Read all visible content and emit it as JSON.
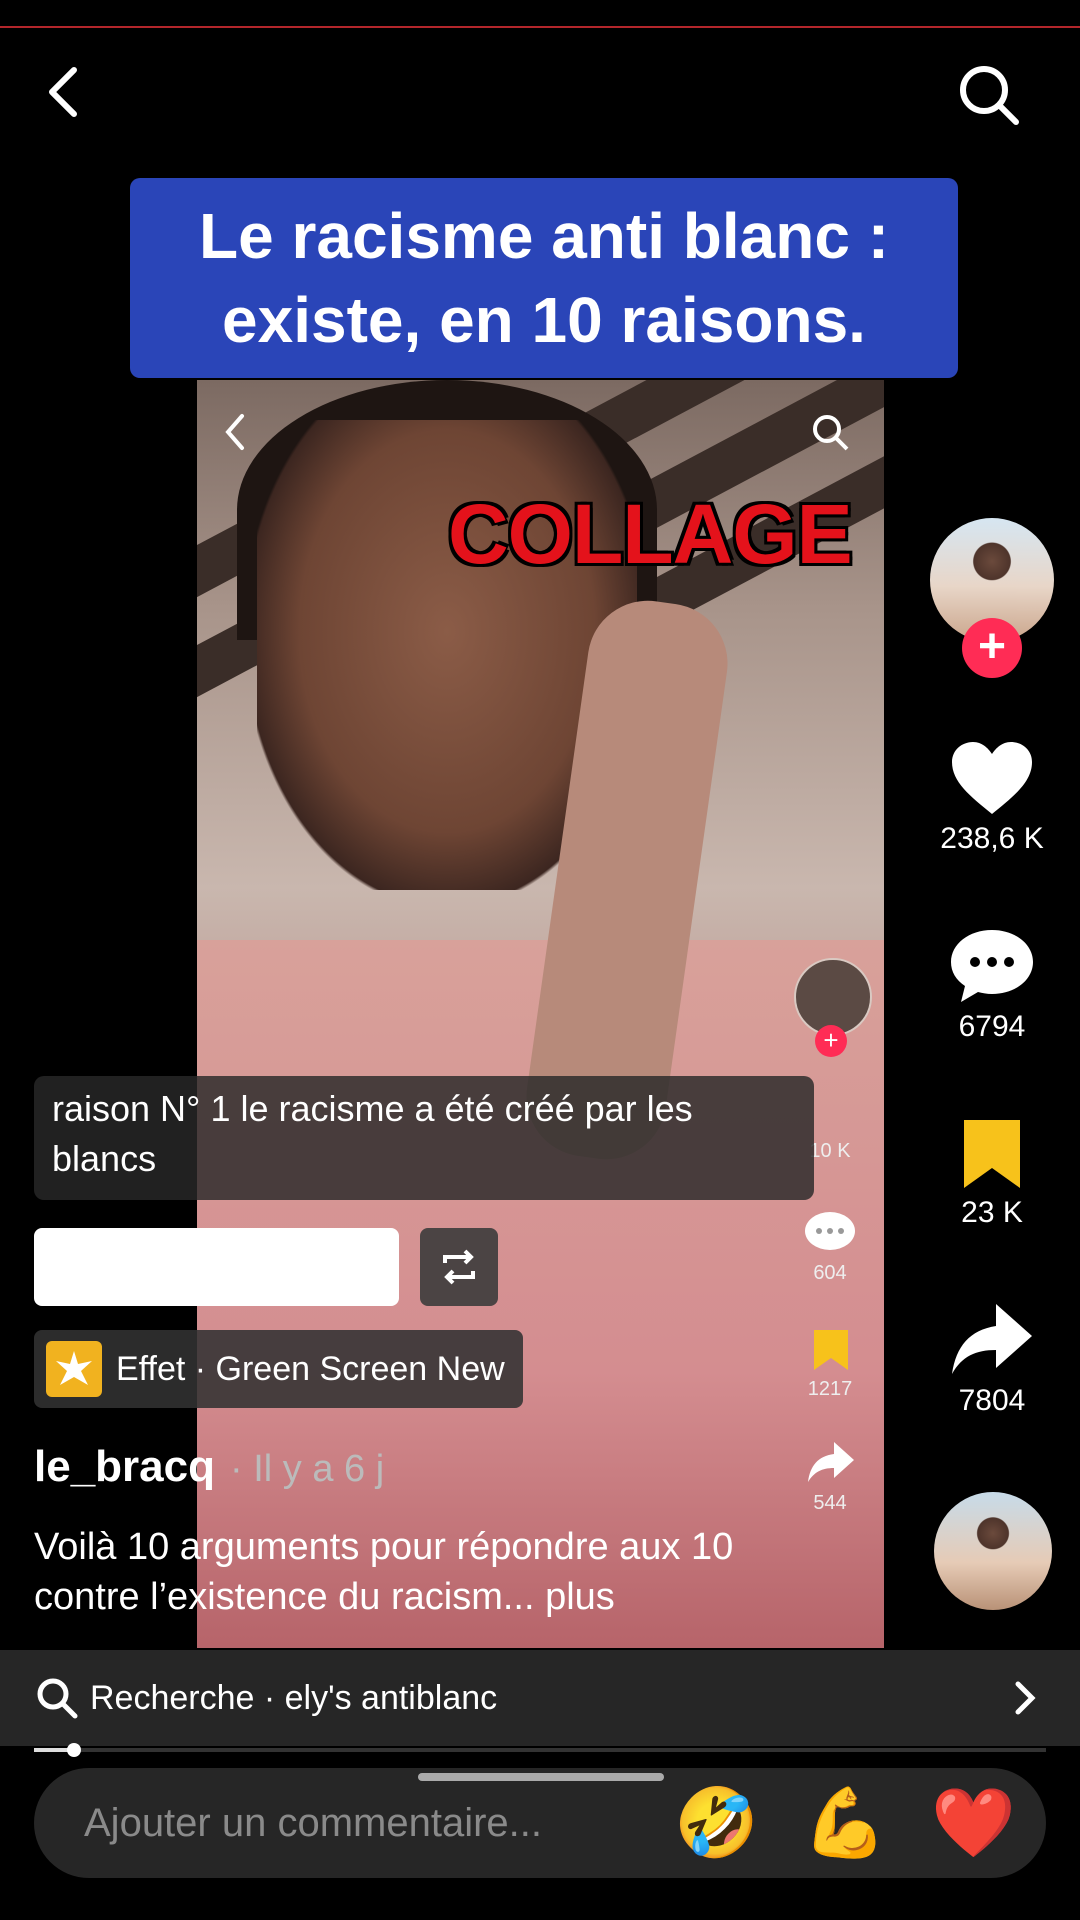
{
  "top_bar": {
    "back_icon": "chevron-left-icon",
    "search_icon": "search-icon"
  },
  "title_banner": {
    "line1": "Le racisme anti blanc :",
    "line2": "existe, en 10 raisons."
  },
  "inner_video": {
    "overlay_text": "COLLAGE",
    "likes": "10 K",
    "comments": "604",
    "saves": "1217",
    "shares": "544"
  },
  "sidebar": {
    "likes": "238,6 K",
    "comments": "6794",
    "saves": "23 K",
    "shares": "7804",
    "save_color": "#f7c21b",
    "follow_color": "#ff2c55"
  },
  "caption": "raison N° 1 le racisme a été créé par les blancs",
  "effect": {
    "label": "Effet · Green Screen New"
  },
  "post": {
    "username": "le_bracq",
    "time": "· Il y a 6 j",
    "description": "Voilà 10 arguments pour répondre aux 10 contre l’existence du racism... plus"
  },
  "search": {
    "label": "Recherche · ely's antiblanc"
  },
  "progress": 0.04,
  "comment": {
    "placeholder": "Ajouter un commentaire...",
    "emojis": [
      "🤣",
      "💪",
      "❤️"
    ]
  }
}
